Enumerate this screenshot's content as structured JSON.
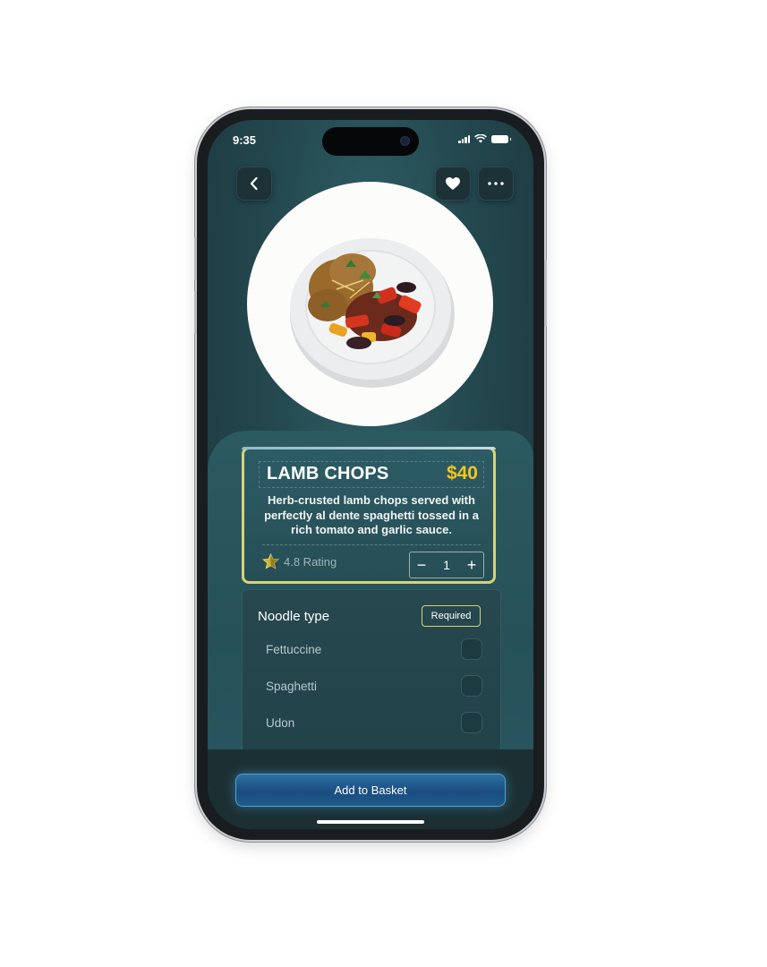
{
  "status_bar": {
    "time": "9:35"
  },
  "nav": {
    "back_icon": "chevron-left-icon",
    "favorite_icon": "heart-icon",
    "more_icon": "more-horizontal-icon"
  },
  "dish": {
    "name": "LAMB CHOPS",
    "price": "$40",
    "description": "Herb-crusted lamb chops served with perfectly al dente spaghetti tossed in a rich tomato and garlic sauce.",
    "rating_text": "4.8 Rating",
    "quantity": "1"
  },
  "stepper": {
    "minus": "−",
    "plus": "+"
  },
  "options": {
    "title": "Noodle type",
    "badge": "Required",
    "items": [
      {
        "label": "Fettuccine",
        "checked": false
      },
      {
        "label": "Spaghetti",
        "checked": false
      },
      {
        "label": "Udon",
        "checked": false
      }
    ]
  },
  "cta": {
    "label": "Add to Basket"
  },
  "colors": {
    "accent_yellow": "#f4c41d",
    "card_border": "#d9d375",
    "button_blue": "#1b4d80",
    "background_teal": "#24484f"
  }
}
